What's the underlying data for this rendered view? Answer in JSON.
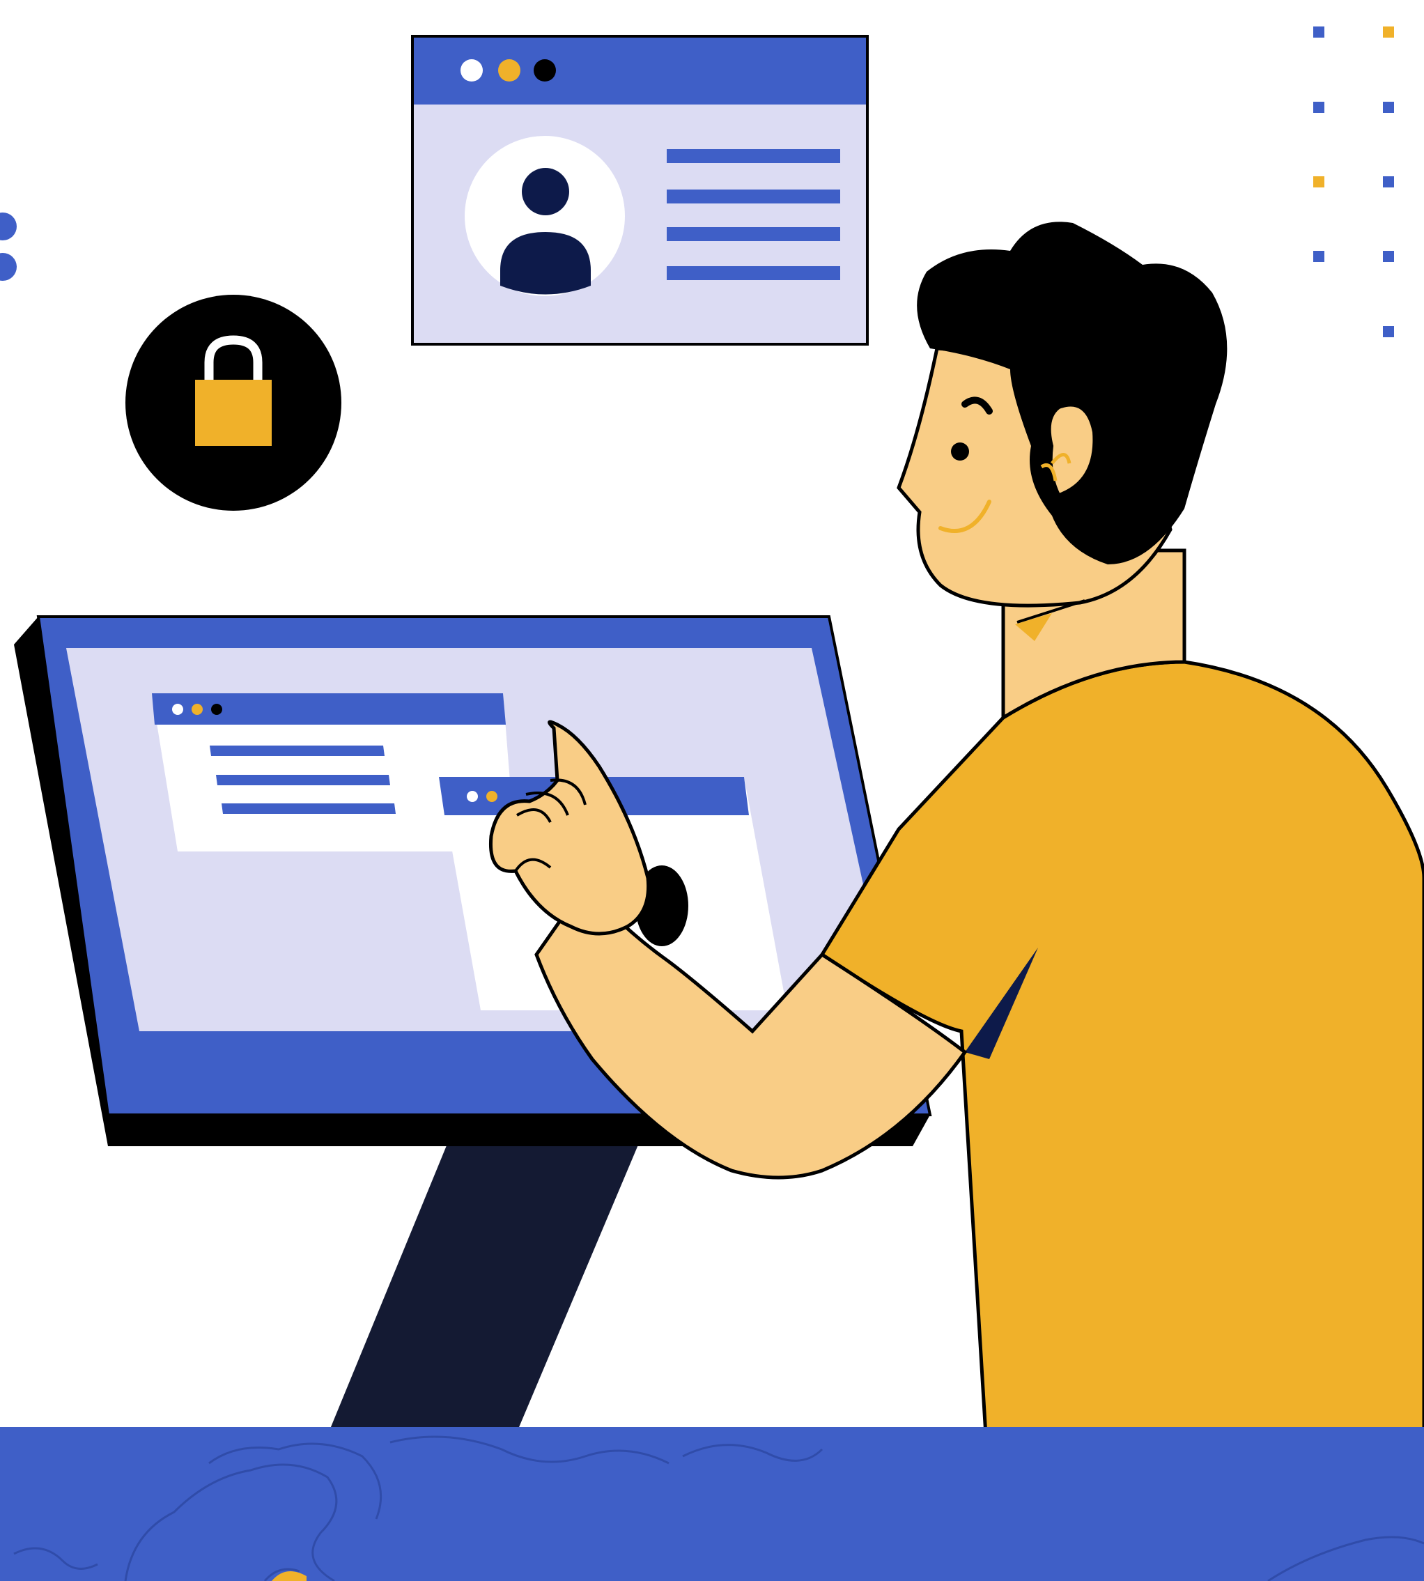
{
  "scene": {
    "subject": "person-using-touchscreen-kiosk",
    "icons": [
      "lock-icon",
      "user-avatar-icon",
      "dots-pattern",
      "world-map"
    ]
  },
  "colors": {
    "background": "#ffffff",
    "brand_blue": "#3f5fc7",
    "screen_lavender": "#dcdcf3",
    "accent_yellow": "#f0b12a",
    "skin": "#f9cd86",
    "outline": "#000000",
    "navy": "#141a33",
    "avatar_navy": "#0d1a4a"
  }
}
